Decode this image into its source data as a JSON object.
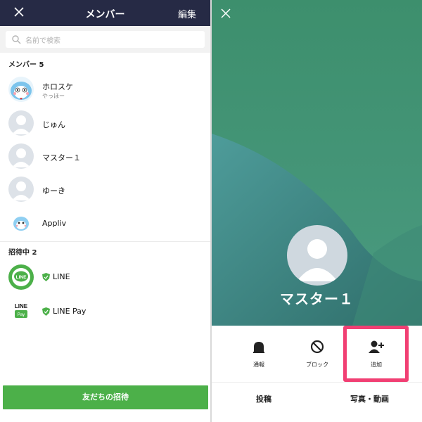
{
  "left": {
    "header": {
      "title": "メンバー",
      "edit": "編集"
    },
    "search": {
      "placeholder": "名前で検索"
    },
    "members_section": "メンバー 5",
    "members": [
      {
        "name": "ホロスケ",
        "status": "やっほー",
        "avatar": "owl-character"
      },
      {
        "name": "じゅん",
        "status": "",
        "avatar": "default-user"
      },
      {
        "name": "マスター１",
        "status": "",
        "avatar": "default-user"
      },
      {
        "name": "ゆーき",
        "status": "",
        "avatar": "default-user"
      },
      {
        "name": "Appliv",
        "status": "",
        "avatar": "owl-small"
      }
    ],
    "invited_section": "招待中 2",
    "invited": [
      {
        "name": "LINE",
        "avatar": "line-logo"
      },
      {
        "name": "LINE Pay",
        "avatar": "line-pay-logo"
      }
    ],
    "invite_button": "友だちの招待"
  },
  "right": {
    "profile_name": "マスター１",
    "actions": [
      {
        "label": "通報",
        "icon": "report-icon"
      },
      {
        "label": "ブロック",
        "icon": "block-icon"
      },
      {
        "label": "追加",
        "icon": "add-friend-icon"
      }
    ],
    "tabs": [
      "投稿",
      "写真・動画"
    ],
    "colors": {
      "bg_top": "#3e8f6f",
      "highlight": "#f13f73",
      "header": "#262a45",
      "button": "#4cb049"
    }
  }
}
